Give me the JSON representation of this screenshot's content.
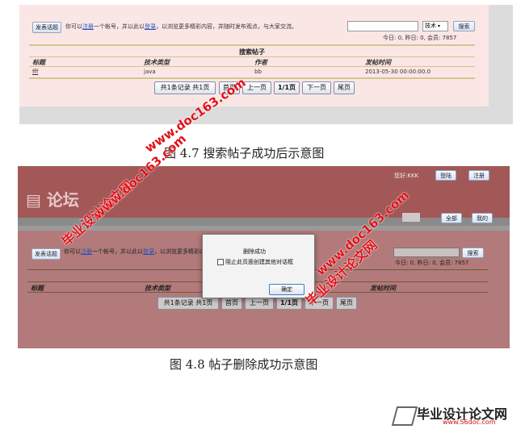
{
  "fig1": {
    "post_button": "发表话题",
    "intro_pre": "你可以",
    "register_link": "注册",
    "intro_mid": "一个帐号，并以此以",
    "login_link": "登录",
    "intro_post": "，以浏览更多精彩内容，并随时发布观点，与大家交流。",
    "search_select": "技术",
    "search_button": "搜索",
    "stats": "今日: 0, 昨日: 0, 会员: 7857",
    "table_title": "搜索帖子",
    "columns": [
      "标题",
      "技术类型",
      "作者",
      "发帖时间"
    ],
    "rows": [
      {
        "title": "fff",
        "type": "java",
        "author": "bb",
        "time": "2013-05-30 00:00:00.0"
      }
    ],
    "pager": {
      "summary": "共1条记录 共1页",
      "first": "首页",
      "prev": "上一页",
      "current": "1/1页",
      "next": "下一页",
      "last": "尾页"
    }
  },
  "caption1": "图 4.7 搜索帖子成功后示意图",
  "fig2": {
    "logo_text": "论坛",
    "greeting": "您好:KKK",
    "logout": "登陆",
    "register": "注册",
    "tabs": [
      "全部",
      "我的"
    ],
    "post_button": "发表话题",
    "intro_pre": "你可以",
    "register_link": "注册",
    "intro_mid": "一个帐号，并以此以",
    "login_link": "登录",
    "intro_post": "，以浏览更多精彩内容，并随时发布观点，与大家交流。",
    "search_button": "搜索",
    "stats": "今日: 0, 昨日: 0, 会员: 7857",
    "columns": [
      "标题",
      "技术类型",
      "作者",
      "发帖时间"
    ],
    "pager": {
      "summary": "共1条记录 共1页",
      "first": "首页",
      "prev": "上一页",
      "current": "1/1页",
      "next": "下一页",
      "last": "尾页"
    },
    "dialog": {
      "message": "删除成功",
      "checkbox_label": "阻止此页面创建其他对话框",
      "ok": "确定"
    }
  },
  "caption2": "图 4.8 帖子删除成功示意图",
  "watermarks": {
    "site_cn": "毕业设计论文网",
    "site_url": "www.doc163.com",
    "footer_cn": "毕业设计论文网",
    "footer_url": "www.56doc.com"
  }
}
